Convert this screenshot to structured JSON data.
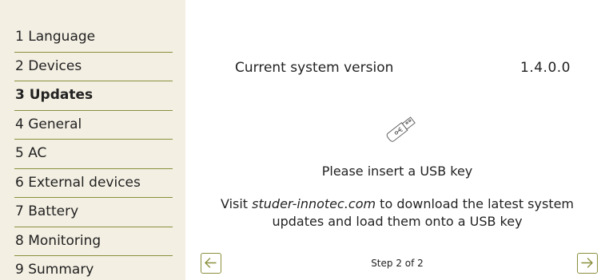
{
  "wizard": {
    "steps": [
      {
        "label": "1 Language"
      },
      {
        "label": "2 Devices"
      },
      {
        "label": "3 Updates",
        "active": true
      },
      {
        "label": "4 General"
      },
      {
        "label": "5 AC"
      },
      {
        "label": "6 External devices"
      },
      {
        "label": "7 Battery"
      },
      {
        "label": "8 Monitoring"
      },
      {
        "label": "9 Summary"
      }
    ],
    "active_step_index": 2
  },
  "updates": {
    "version_label": "Current system version",
    "version_value": "1.4.0.0",
    "usb_icon": "usb-key-icon",
    "insert_message": "Please insert a USB key",
    "visit_prefix": "Visit ",
    "visit_site": "studer-innotec.com",
    "visit_suffix": " to download the latest system updates and load them onto a USB key"
  },
  "navigation": {
    "prev_icon": "arrow-left-icon",
    "next_icon": "arrow-right-icon",
    "step_indicator": "Step 2 of 2"
  },
  "colors": {
    "sidebar_bg": "#f3efe3",
    "accent": "#8a8f3c",
    "text": "#222222"
  }
}
